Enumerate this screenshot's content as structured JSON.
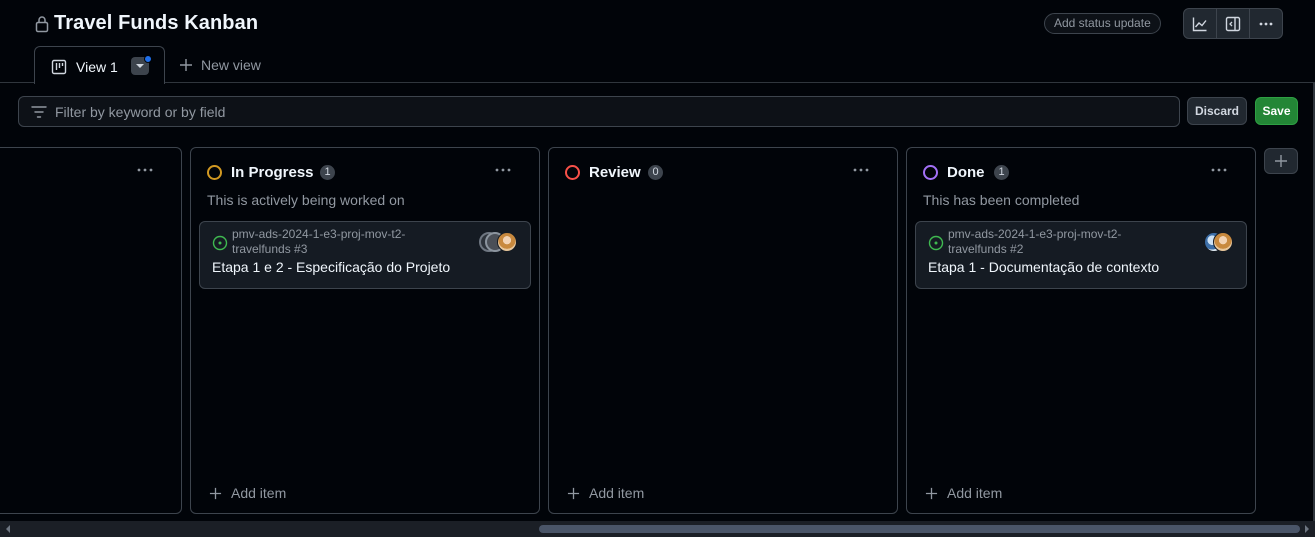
{
  "header": {
    "title": "Travel Funds Kanban",
    "status_update_label": "Add status update"
  },
  "tabs": [
    {
      "label": "View 1",
      "active": true
    },
    {
      "label": "New view"
    }
  ],
  "filter": {
    "placeholder": "Filter by keyword or by field",
    "discard_label": "Discard",
    "save_label": "Save"
  },
  "columns": [
    {
      "name": "In Progress",
      "count": "1",
      "color": "#d29922",
      "description": "This is actively being worked on",
      "cards": [
        {
          "repo": "pmv-ads-2024-1-e3-proj-mov-t2-",
          "repo_number": "travelfunds #3",
          "title": "Etapa 1 e 2 - Especificação do Projeto"
        }
      ],
      "add_label": "Add item"
    },
    {
      "name": "Review",
      "count": "0",
      "color": "#f85149",
      "description": "",
      "cards": [],
      "add_label": "Add item"
    },
    {
      "name": "Done",
      "count": "1",
      "color": "#a371f7",
      "description": "This has been completed",
      "cards": [
        {
          "repo": "pmv-ads-2024-1-e3-proj-mov-t2-",
          "repo_number": "travelfunds #2",
          "title": "Etapa 1 - Documentação de contexto"
        }
      ],
      "add_label": "Add item"
    }
  ],
  "colors": {
    "accent_green": "#238636",
    "open_issue": "#3fb950"
  },
  "icons": [
    "lock-icon",
    "insights-icon",
    "side-panel-icon",
    "kebab-icon",
    "board-icon",
    "chevron-down-icon",
    "plus-icon",
    "filter-icon",
    "issue-open-icon"
  ]
}
